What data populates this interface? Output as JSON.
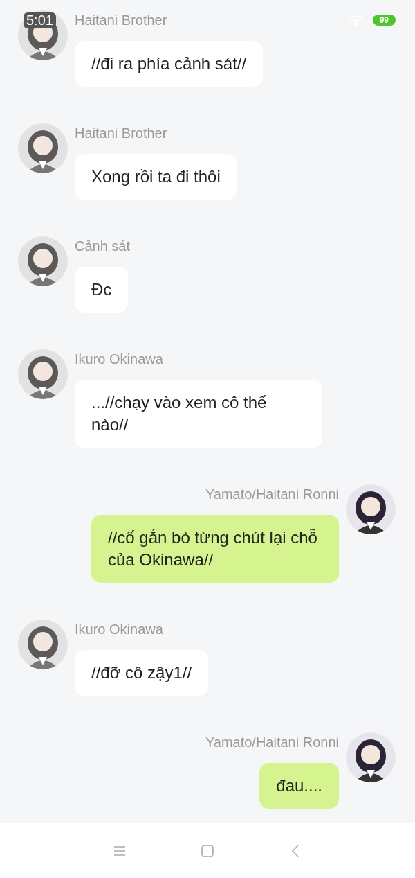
{
  "status_bar": {
    "time": "5:01",
    "battery": "99"
  },
  "messages": [
    {
      "kind": "received",
      "sender": "Haitani Brother",
      "text": "//đi ra phía cảnh sát//"
    },
    {
      "kind": "received",
      "sender": "Haitani Brother",
      "text": "Xong rồi ta đi thôi"
    },
    {
      "kind": "received",
      "sender": "Cảnh sát",
      "text": "Đc"
    },
    {
      "kind": "received",
      "sender": "Ikuro Okinawa",
      "text": "...//chạy vào xem cô thế nào//"
    },
    {
      "kind": "sent",
      "sender": "Yamato/Haitani Ronni",
      "text": "//cố gắn bò từng chút lại chỗ của Okinawa//"
    },
    {
      "kind": "received",
      "sender": "Ikuro Okinawa",
      "text": "//đỡ cô zậy1//"
    },
    {
      "kind": "sent",
      "sender": "Yamato/Haitani Ronni",
      "text": "đau...."
    }
  ]
}
